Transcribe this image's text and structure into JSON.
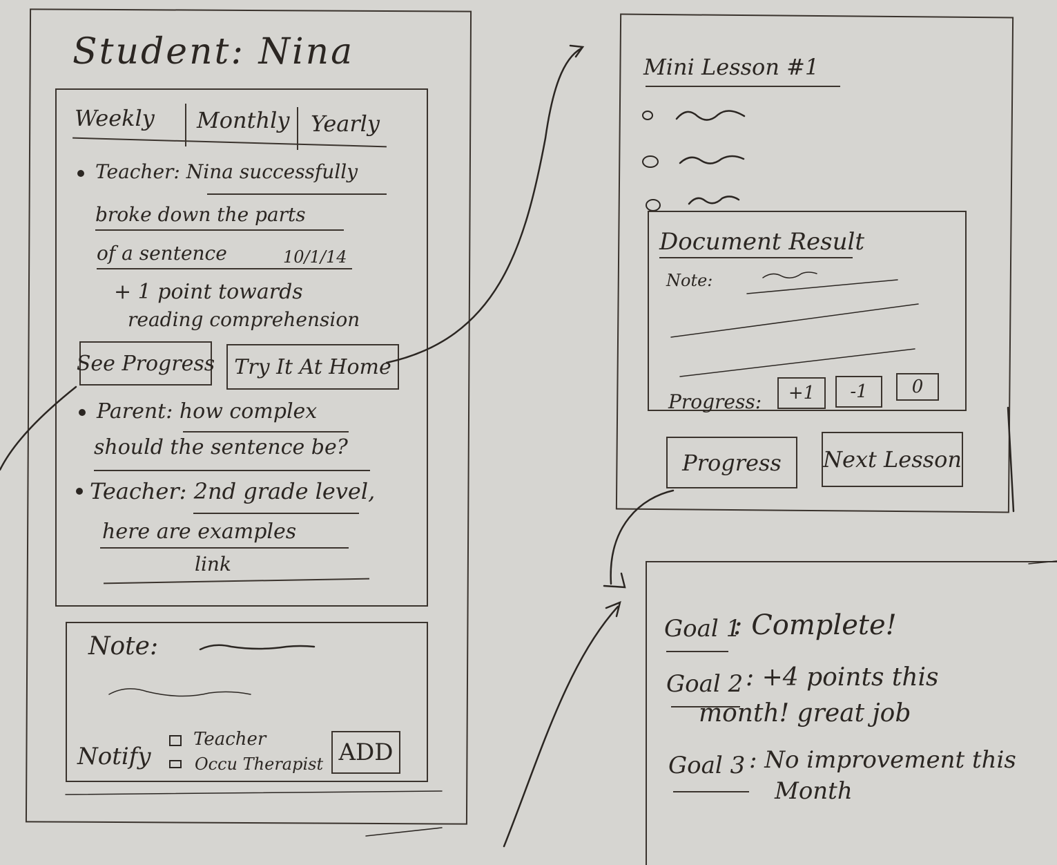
{
  "student_screen": {
    "title": "Student: Nina",
    "tabs": [
      "Weekly",
      "Monthly",
      "Yearly"
    ],
    "feed": [
      {
        "line1": "Teacher: Nina successfully",
        "line2": "broke down the parts",
        "line3": "of a sentence",
        "date": "10/1/14"
      },
      {
        "reward1": "+ 1 point towards",
        "reward2": "reading comprehension"
      },
      {
        "line1": "Parent: how complex",
        "line2": "should the sentence be?"
      },
      {
        "line1": "Teacher: 2nd grade level,",
        "line2": "here are examples",
        "line3": "link"
      }
    ],
    "see_progress_label": "See Progress",
    "try_at_home_label": "Try It At Home",
    "note_label": "Note:",
    "notify_label": "Notify",
    "notify_options": [
      "Teacher",
      "Occu Therapist"
    ],
    "add_label": "ADD"
  },
  "lesson_screen": {
    "title": "Mini Lesson #1",
    "document_result_title": "Document Result",
    "note_label": "Note:",
    "progress_label": "Progress:",
    "progress_buttons": [
      "+1",
      "-1",
      "0"
    ],
    "progress_button_label": "Progress",
    "next_lesson_label": "Next Lesson"
  },
  "goals_screen": {
    "goals": [
      {
        "name": "Goal 1",
        "text": ": Complete!"
      },
      {
        "name": "Goal 2",
        "text": ": +4 points this",
        "text2": "month! great job"
      },
      {
        "name": "Goal 3",
        "text": ": No improvement this",
        "text2": "Month"
      }
    ]
  }
}
